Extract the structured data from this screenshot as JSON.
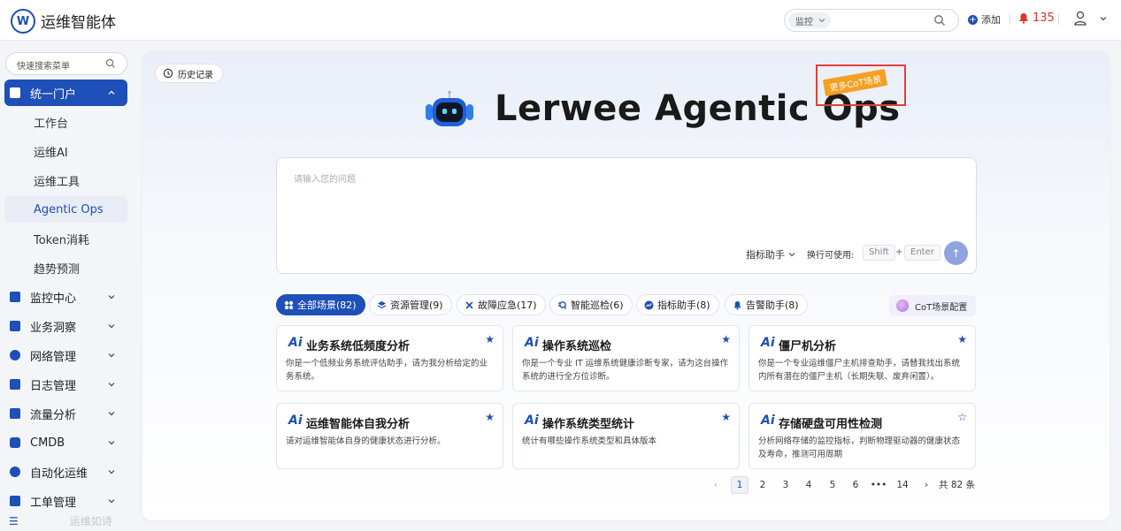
{
  "app": {
    "title": "运维智能体",
    "logo_letter": "W"
  },
  "header": {
    "search_scope": "监控",
    "add_label": "添加",
    "alert_count": "135"
  },
  "sidebar": {
    "search_placeholder": "快速搜索菜单",
    "groups": [
      {
        "label": "统一门户",
        "icon": "portal-icon",
        "expanded": true,
        "color": "#ffffff"
      },
      {
        "label": "监控中心",
        "icon": "monitor-icon",
        "color": "#1f4fb8"
      },
      {
        "label": "业务洞察",
        "icon": "insight-icon",
        "color": "#1f4fb8"
      },
      {
        "label": "网络管理",
        "icon": "network-icon",
        "color": "#1f4fb8"
      },
      {
        "label": "日志管理",
        "icon": "log-icon",
        "color": "#1f4fb8"
      },
      {
        "label": "流量分析",
        "icon": "traffic-icon",
        "color": "#1f4fb8"
      },
      {
        "label": "CMDB",
        "icon": "cmdb-icon",
        "color": "#1f4fb8"
      },
      {
        "label": "自动化运维",
        "icon": "automation-icon",
        "color": "#1f4fb8"
      },
      {
        "label": "工单管理",
        "icon": "ticket-icon",
        "color": "#1f4fb8"
      }
    ],
    "sub_items": [
      "工作台",
      "运维AI",
      "运维工具",
      "Agentic Ops",
      "Token消耗",
      "趋势预测"
    ],
    "selected_sub": "Agentic Ops",
    "bottom_hint": "运维如诗"
  },
  "main": {
    "history_label": "历史记录",
    "hero_title": "Lerwee Agentic Ops",
    "cot_badge": "更多CoT场景",
    "prompt_placeholder": "请输入您的问题",
    "assistant_select": "指标助手",
    "newline_label": "换行可使用:",
    "key_shift": "Shift",
    "key_plus": "+",
    "key_enter": "Enter",
    "tabs": [
      {
        "label": "全部场景(82)",
        "icon": "grid-icon",
        "active": true
      },
      {
        "label": "资源管理(9)",
        "icon": "layers-icon"
      },
      {
        "label": "故障应急(17)",
        "icon": "tools-icon"
      },
      {
        "label": "智能巡检(6)",
        "icon": "inspect-icon"
      },
      {
        "label": "指标助手(8)",
        "icon": "trend-icon"
      },
      {
        "label": "告警助手(8)",
        "icon": "bell-icon"
      }
    ],
    "cot_config_label": "CoT场景配置",
    "cards": [
      {
        "title": "业务系统低频度分析",
        "desc": "你是一个低频业务系统评估助手，请为我分析给定的业务系统。",
        "starred": true
      },
      {
        "title": "操作系统巡检",
        "desc": "你是一个专业 IT 运维系统健康诊断专家，请为这台操作系统的进行全方位诊断。",
        "starred": true
      },
      {
        "title": "僵尸机分析",
        "desc": "你是一个专业运维僵尸主机排查助手，请替我找出系统内所有潜在的僵尸主机（长期失联、废弃闲置）。",
        "starred": true
      },
      {
        "title": "运维智能体自我分析",
        "desc": "请对运维智能体自身的健康状态进行分析。",
        "starred": true
      },
      {
        "title": "操作系统类型统计",
        "desc": "统计有哪些操作系统类型和具体版本",
        "starred": true
      },
      {
        "title": "存储硬盘可用性检测",
        "desc": "分析网络存储的监控指标，判断物理驱动器的健康状态及寿命，推测可用周期",
        "starred": false
      }
    ],
    "card_ai_mark": "Ai",
    "pagination": {
      "pages": [
        "1",
        "2",
        "3",
        "4",
        "5",
        "6",
        "•••",
        "14"
      ],
      "current": "1",
      "total": "共 82 条"
    }
  }
}
